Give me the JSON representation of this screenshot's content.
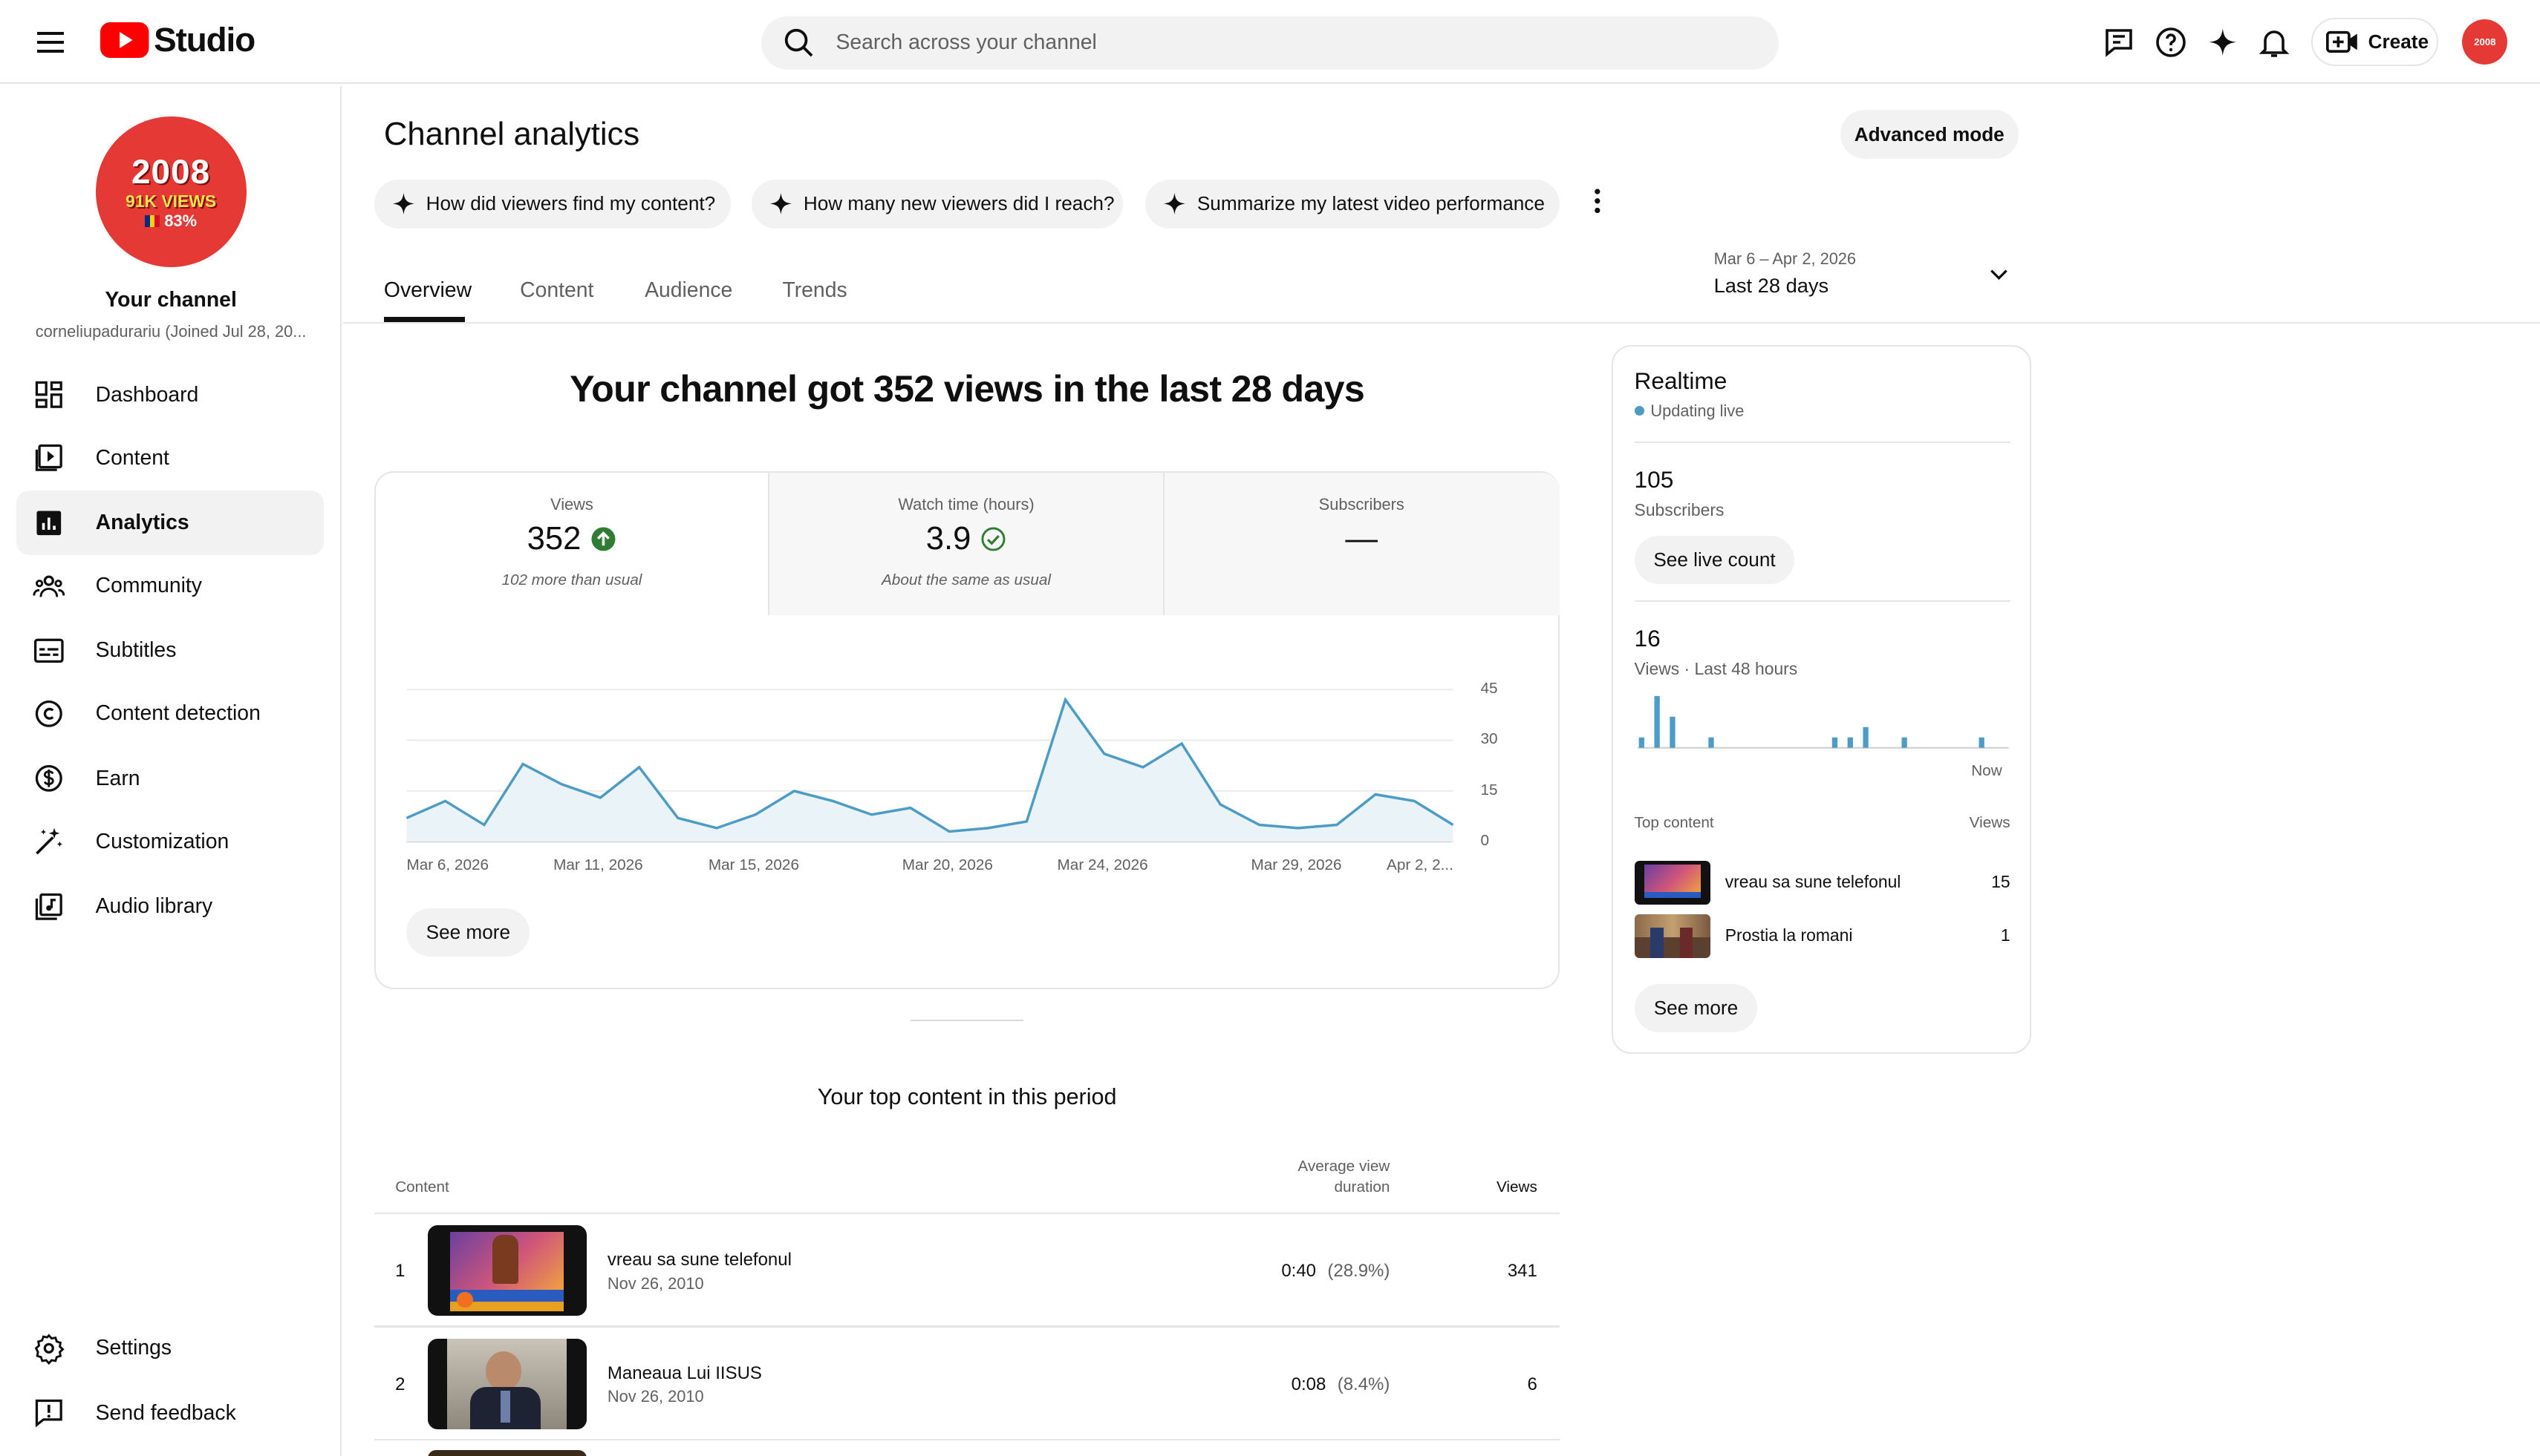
{
  "header": {
    "app_name": "Studio",
    "search_placeholder": "Search across your channel",
    "create_label": "Create"
  },
  "channel": {
    "name": "Your channel",
    "handle": "corneliupadurariu (Joined Jul 28, 20...",
    "avatar_lines": [
      "2008",
      "91K VIEWS",
      "83%"
    ]
  },
  "sidebar": {
    "items": [
      {
        "label": "Dashboard",
        "icon": "dashboard-icon"
      },
      {
        "label": "Content",
        "icon": "content-icon"
      },
      {
        "label": "Analytics",
        "icon": "analytics-icon"
      },
      {
        "label": "Community",
        "icon": "community-icon"
      },
      {
        "label": "Subtitles",
        "icon": "subtitles-icon"
      },
      {
        "label": "Content detection",
        "icon": "copyright-icon"
      },
      {
        "label": "Earn",
        "icon": "earn-icon"
      },
      {
        "label": "Customization",
        "icon": "customization-icon"
      },
      {
        "label": "Audio library",
        "icon": "audio-library-icon"
      }
    ],
    "bottom": [
      {
        "label": "Settings",
        "icon": "gear-icon"
      },
      {
        "label": "Send feedback",
        "icon": "feedback-icon"
      }
    ]
  },
  "page": {
    "title": "Channel analytics",
    "advanced_mode": "Advanced mode",
    "chips": [
      "How did viewers find my content?",
      "How many new viewers did I reach?",
      "Summarize my latest video performance"
    ],
    "tabs": [
      "Overview",
      "Content",
      "Audience",
      "Trends"
    ],
    "date_range": "Mar 6 – Apr 2, 2026",
    "date_label": "Last 28 days"
  },
  "overview": {
    "headline": "Your channel got 352 views in the last 28 days",
    "metrics": [
      {
        "label": "Views",
        "value": "352",
        "sub": "102 more than usual",
        "status": "up"
      },
      {
        "label": "Watch time (hours)",
        "value": "3.9",
        "sub": "About the same as usual",
        "status": "check"
      },
      {
        "label": "Subscribers",
        "value": "—",
        "sub": "",
        "status": "none"
      }
    ],
    "see_more": "See more"
  },
  "chart_data": {
    "type": "area",
    "x_tick_labels": [
      "Mar 6, 2026",
      "Mar 11, 2026",
      "Mar 15, 2026",
      "Mar 20, 2026",
      "Mar 24, 2026",
      "Mar 29, 2026",
      "Apr 2, 2..."
    ],
    "x": [
      "Mar 6",
      "Mar 7",
      "Mar 8",
      "Mar 9",
      "Mar 10",
      "Mar 11",
      "Mar 12",
      "Mar 13",
      "Mar 14",
      "Mar 15",
      "Mar 16",
      "Mar 17",
      "Mar 18",
      "Mar 19",
      "Mar 20",
      "Mar 21",
      "Mar 22",
      "Mar 23",
      "Mar 24",
      "Mar 25",
      "Mar 26",
      "Mar 27",
      "Mar 28",
      "Mar 29",
      "Mar 30",
      "Mar 31",
      "Apr 1",
      "Apr 2"
    ],
    "values": [
      7,
      12,
      5,
      23,
      17,
      13,
      22,
      7,
      4,
      8,
      15,
      12,
      8,
      10,
      3,
      4,
      6,
      42,
      26,
      22,
      29,
      11,
      5,
      4,
      5,
      14,
      12,
      5
    ],
    "ylim": [
      0,
      45
    ],
    "y_ticks": [
      0,
      15,
      30,
      45
    ],
    "grid": true,
    "color": "#4c9cc7"
  },
  "realtime": {
    "title": "Realtime",
    "status": "Updating live",
    "subscribers_value": "105",
    "subscribers_label": "Subscribers",
    "see_live_count": "See live count",
    "views_value": "16",
    "views_label": "Views · Last 48 hours",
    "now_label": "Now",
    "bars": [
      1,
      0,
      5,
      0,
      3,
      0,
      0,
      0,
      0,
      1,
      0,
      0,
      0,
      0,
      0,
      0,
      0,
      0,
      0,
      0,
      0,
      0,
      0,
      0,
      0,
      1,
      0,
      1,
      0,
      2,
      0,
      0,
      0,
      0,
      1,
      0,
      0,
      0,
      0,
      0,
      0,
      0,
      0,
      0,
      1,
      0,
      0,
      0
    ],
    "top_content_header": "Top content",
    "views_header": "Views",
    "top_content": [
      {
        "title": "vreau sa sune telefonul",
        "views": "15"
      },
      {
        "title": "Prostia la romani",
        "views": "1"
      }
    ],
    "see_more": "See more"
  },
  "top_content_section": {
    "title": "Your top content in this period",
    "col_content": "Content",
    "col_avg_line1": "Average view",
    "col_avg_line2": "duration",
    "col_views": "Views",
    "rows": [
      {
        "rank": "1",
        "title": "vreau sa sune telefonul",
        "date": "Nov 26, 2010",
        "avg": "0:40",
        "pct": "(28.9%)",
        "views": "341"
      },
      {
        "rank": "2",
        "title": "Maneaua Lui IISUS",
        "date": "Nov 26, 2010",
        "avg": "0:08",
        "pct": "(8.4%)",
        "views": "6"
      }
    ]
  },
  "colors": {
    "brand_red": "#ff0000",
    "accent_blue": "#4c9cc7",
    "up_green": "#2e7d32"
  }
}
